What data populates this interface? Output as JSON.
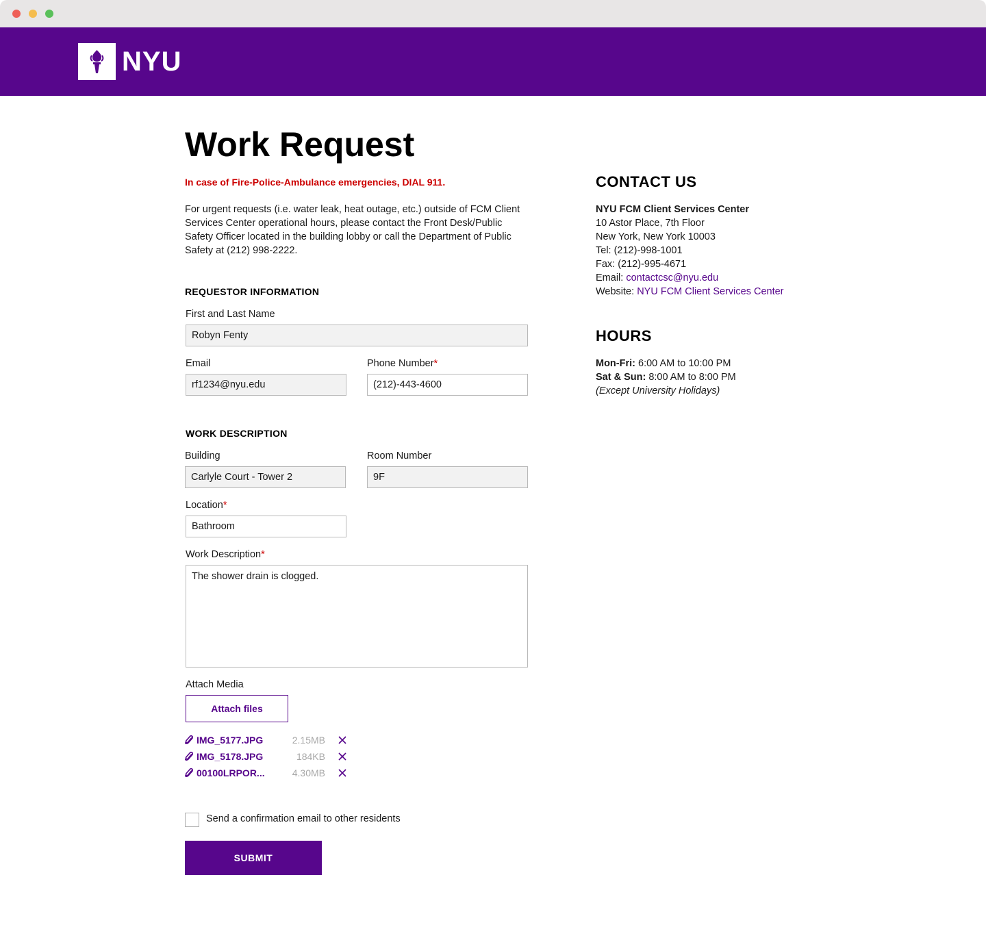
{
  "header": {
    "logo_text": "NYU",
    "brand_color": "#57068c"
  },
  "page": {
    "title": "Work Request",
    "emergency_notice": "In case of Fire-Police-Ambulance emergencies, DIAL 911.",
    "urgent_notice": "For urgent requests (i.e. water leak, heat outage, etc.) outside of FCM Client Services Center operational hours, please contact the Front Desk/Public Safety Officer located in the building lobby or call the Department of Public Safety at (212) 998-2222."
  },
  "requestor": {
    "heading": "REQUESTOR INFORMATION",
    "name_label": "First and Last Name",
    "name_value": "Robyn Fenty",
    "email_label": "Email",
    "email_value": "rf1234@nyu.edu",
    "phone_label": "Phone Number",
    "phone_value": "(212)-443-4600",
    "required_mark": "*"
  },
  "work": {
    "heading": "WORK DESCRIPTION",
    "building_label": "Building",
    "building_value": "Carlyle Court - Tower 2",
    "room_label": "Room Number",
    "room_value": "9F",
    "location_label": "Location",
    "location_value": "Bathroom",
    "description_label": "Work Description",
    "description_value": "The shower drain is clogged.",
    "attach_label": "Attach Media",
    "attach_button": "Attach files",
    "files": [
      {
        "name": "IMG_5177.JPG",
        "size": "2.15MB"
      },
      {
        "name": "IMG_5178.JPG",
        "size": "184KB"
      },
      {
        "name": "00100LRPOR...",
        "size": "4.30MB"
      }
    ]
  },
  "confirm": {
    "checkbox_label": "Send a confirmation email to other residents",
    "checked": false
  },
  "submit_label": "SUBMIT",
  "contact": {
    "heading": "CONTACT US",
    "org": "NYU FCM Client Services Center",
    "address1": "10 Astor Place, 7th Floor",
    "address2": "New York, New York 10003",
    "tel": "Tel: (212)-998-1001",
    "fax": "Fax: (212)-995-4671",
    "email_prefix": "Email:",
    "email_link": "contactcsc@nyu.edu",
    "website_prefix": "Website:",
    "website_link": "NYU FCM Client Services Center"
  },
  "hours": {
    "heading": "HOURS",
    "weekday_label": "Mon-Fri:",
    "weekday_value": "6:00 AM to 10:00 PM",
    "weekend_label": "Sat & Sun:",
    "weekend_value": "8:00 AM to 8:00 PM",
    "note": "(Except University Holidays)"
  }
}
